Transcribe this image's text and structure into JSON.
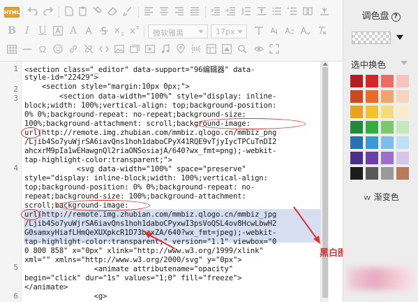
{
  "toolbar": {
    "html_label": "HTML",
    "font_family_value": "微软雅黑",
    "font_size_value": "17px"
  },
  "editor": {
    "line_numbers": [
      "1",
      "2",
      "3",
      "4",
      "5",
      "6"
    ],
    "lines": [
      "<section class=\"_editor\" data-support=\"96编辑器\" data-",
      "style-id=\"22429\">",
      "    <section style=\"margin:10px 0px;\">",
      "        <section data-width=\"100%\" style=\"display: inline-",
      "block;width: 100%;vertical-align: top;background-position:",
      "0% 0%;background-repeat: no-repeat;background-size:",
      "100%;background-attachment: scroll;background-image:",
      "url(http://remote.img.zhubian.com/mmbiz.qlogo.cn/mmbiz_png",
      "/Ljib4So7yuWjrSA6iavQns1hoh1daboCPyX41RQE9vTjyIycTPCuTnDI2",
      "ahcxrM9pIa1wEHawgnQl2riaONSosiajA/640?wx_fmt=png);-webkit-",
      "tap-highlight-color:transparent;\">",
      "            <svg data-width=\"100%\" space=\"preserve\"",
      "style=\"display: inline-block;width: 100%;vertical-align:",
      "top;background-position: 0% 0%;background-repeat: no-",
      "repeat;background-size: 100%;background-attachment:",
      "scroll;background-image:",
      "url(http://remote.img.zhubian.com/mmbiz.qlogo.cn/mmbiz_jpg",
      "/Ljib4So7yuWjrSA6iavQns1hoh1daboCPyxwI3psVoQSL4ov8HcwLbwH2",
      "G0samxyHiafLHmQeXUXpkcR1D73bzxZA/640?wx_fmt=jpeg);-webkit-",
      "tap-highlight-color:transparent;\" version=\"1.1\" viewbox=\"0",
      "0 800 858\" x=\"0px\" xlink=\"http://www.w3.org/1999/xlink\"",
      "xml=\"\" xmlns=\"http://www.w3.org/2000/svg\" y=\"0px\">",
      "                <animate attributename=\"opacity\"",
      "begin=\"click\" dur=\"1s\" values=\"1;0\" fill=\"freeze\">",
      "</animate>",
      "                <g>"
    ]
  },
  "annotation": {
    "callout_text": "黑白图链接替换",
    "color": "#e0302b"
  },
  "panel": {
    "title": "调色盘",
    "help_glyph": "?",
    "section_label": "选中换色",
    "gradient_label": "渐变色",
    "gradient_icon": "double-chevron-down-icon",
    "swatches": [
      [
        "#b41e23",
        "#d92627",
        "#ec6d66",
        "#f7c4c0"
      ],
      [
        "#c74b1f",
        "#ea6a29",
        "#f0a36d",
        "#f7d6bd"
      ],
      [
        "#e8a21c",
        "#f3c32b",
        "#f5dc7b",
        "#f8edc6"
      ],
      [
        "#1f8a3c",
        "#36ad3f",
        "#7cc86f",
        "#c6e6bb"
      ],
      [
        "#2573b5",
        "#3a9ad9",
        "#7ebde9",
        "#c2e0f4"
      ],
      [
        "#4a2f86",
        "#6f3fa9",
        "#9c6fc8",
        "#d6c6ea"
      ],
      [
        "#1c1c1c",
        "#5a5a5a",
        "#9a9a9a",
        "#b77a5a"
      ]
    ]
  }
}
